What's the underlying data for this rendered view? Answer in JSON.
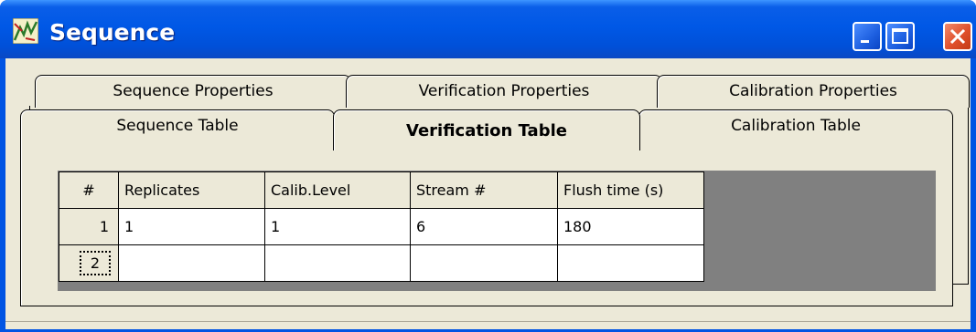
{
  "window": {
    "title": "Sequence",
    "colors": {
      "titlebar": "#0054e3",
      "face": "#ece9d8",
      "grid_empty": "#808080"
    }
  },
  "icons": {
    "app": "sequence-app-icon",
    "minimize": "minimize-icon",
    "maximize": "maximize-icon",
    "close": "close-icon"
  },
  "tabs": {
    "back_row": [
      "Sequence Properties",
      "Verification Properties",
      "Calibration Properties"
    ],
    "front_row": [
      "Sequence Table",
      "Verification Table",
      "Calibration Table"
    ],
    "active": "Verification Table"
  },
  "table": {
    "columns": [
      "#",
      "Replicates",
      "Calib.Level",
      "Stream #",
      "Flush time (s)"
    ],
    "rows": [
      {
        "num": "1",
        "replicates": "1",
        "calib_level": "1",
        "stream": "6",
        "flush_time": "180"
      },
      {
        "num": "2",
        "replicates": "",
        "calib_level": "",
        "stream": "",
        "flush_time": ""
      }
    ]
  }
}
